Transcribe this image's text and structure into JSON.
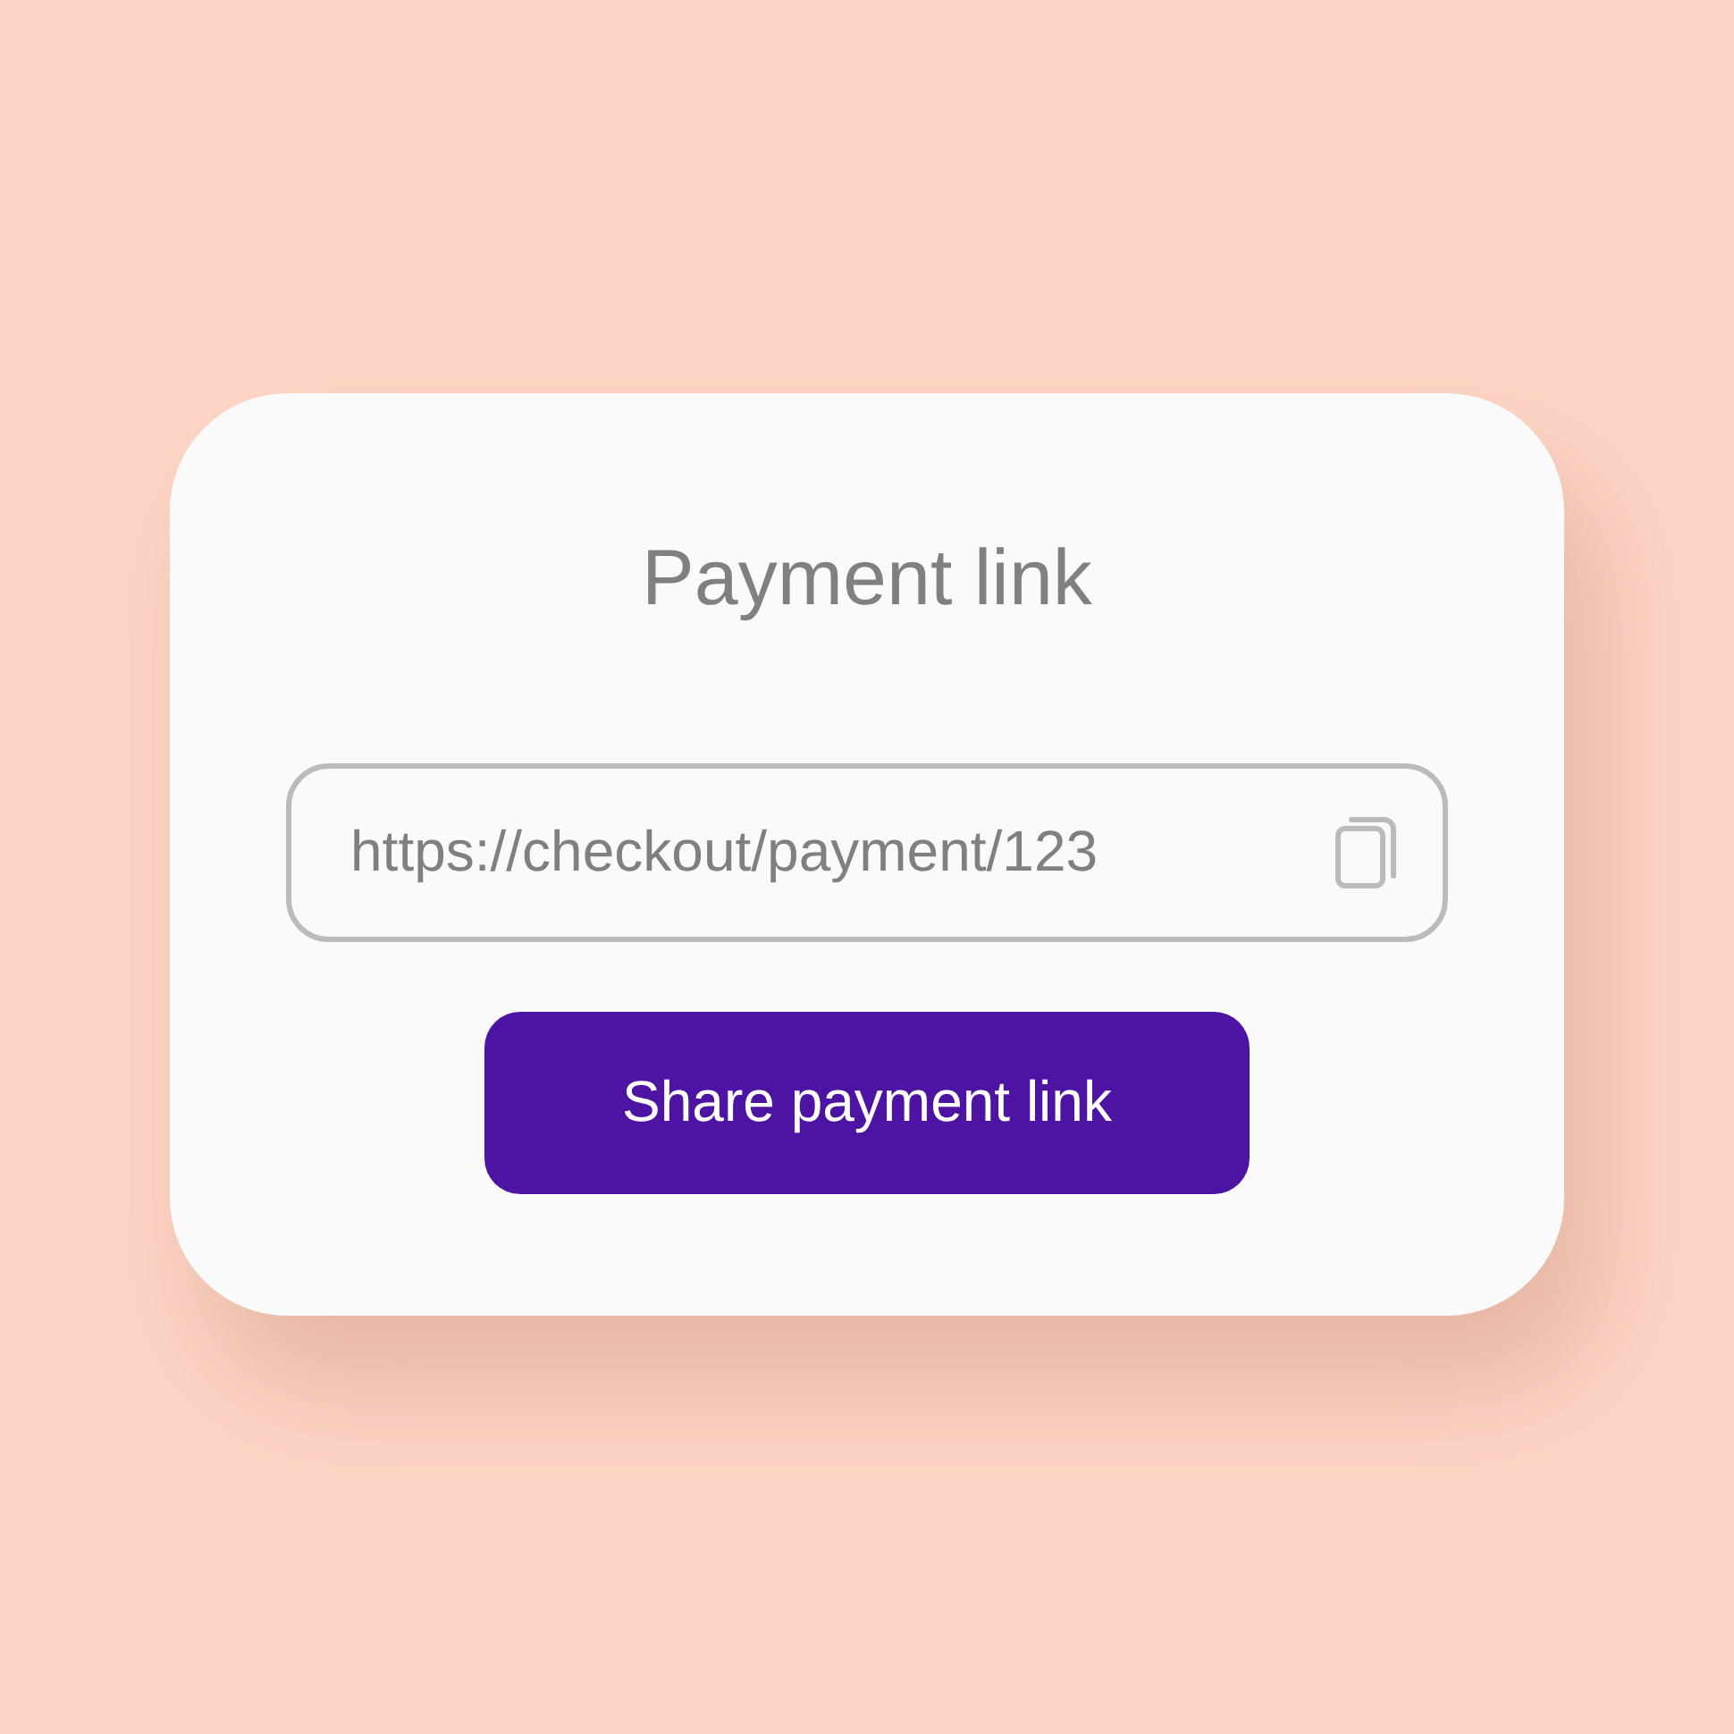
{
  "card": {
    "title": "Payment link",
    "link_field": {
      "value": "https://checkout/payment/123"
    },
    "button": {
      "label": "Share payment link"
    }
  }
}
